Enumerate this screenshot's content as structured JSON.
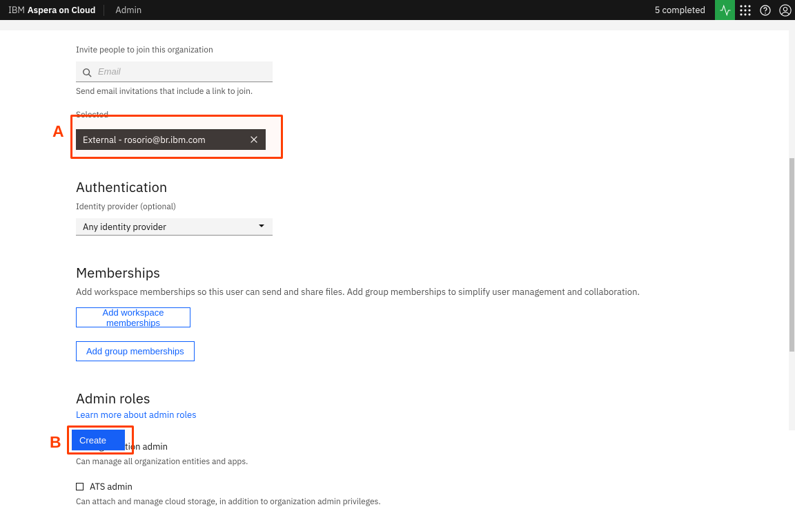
{
  "header": {
    "brand_prefix": "IBM",
    "brand_name": "Aspera on Cloud",
    "app_title": "Admin",
    "completed_text": "5 completed"
  },
  "invite": {
    "label": "Invite people to join this organization",
    "placeholder": "Email",
    "helper": "Send email invitations that include a link to join."
  },
  "selected": {
    "label": "Selected",
    "chip_text": "External - rosorio@br.ibm.com"
  },
  "authentication": {
    "heading": "Authentication",
    "idp_label": "Identity provider (optional)",
    "idp_value": "Any identity provider"
  },
  "memberships": {
    "heading": "Memberships",
    "description": "Add workspace memberships so this user can send and share files. Add group memberships to simplify user management and collaboration.",
    "add_workspace_label": "Add workspace memberships",
    "add_group_label": "Add group memberships"
  },
  "admin_roles": {
    "heading": "Admin roles",
    "learn_more": "Learn more about admin roles",
    "org_admin": {
      "label": "Organization admin",
      "desc": "Can manage all organization entities and apps."
    },
    "ats_admin": {
      "label": "ATS admin",
      "desc": "Can attach and manage cloud storage, in addition to organization admin privileges."
    }
  },
  "actions": {
    "create_label": "Create"
  },
  "callouts": {
    "a": "A",
    "b": "B"
  },
  "icons": {
    "search": "search-icon",
    "close": "close-icon",
    "chevron": "chevron-down-icon",
    "pulse": "activity-icon",
    "apps": "app-switcher-icon",
    "help": "help-icon",
    "user": "user-avatar-icon"
  },
  "colors": {
    "primary": "#0f62fe",
    "header_bg": "#161616",
    "chip_bg": "#393939",
    "pulse_bg": "#24a148",
    "callout": "#ff3d00"
  }
}
